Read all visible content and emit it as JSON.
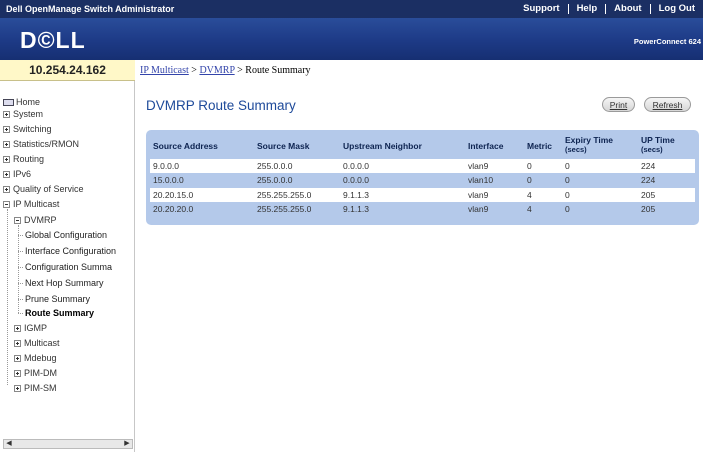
{
  "app": {
    "title": "Dell OpenManage Switch Administrator",
    "links": [
      "Support",
      "Help",
      "About",
      "Log Out"
    ],
    "logo": "D©LL",
    "product": "PowerConnect 624"
  },
  "ip_address": "10.254.24.162",
  "breadcrumb": {
    "items": [
      "IP Multicast",
      "DVMRP",
      "Route Summary"
    ],
    "separator": ">"
  },
  "sidebar": {
    "home": "Home",
    "top_items": [
      "System",
      "Switching",
      "Statistics/RMON",
      "Routing",
      "IPv6",
      "Quality of Service",
      "IP Multicast"
    ],
    "multicast_child": "DVMRP",
    "dvmrp_children": [
      "Global Configuration",
      "Interface Configuration",
      "Configuration Summa",
      "Next Hop Summary",
      "Prune Summary",
      "Route Summary"
    ],
    "multicast_items": [
      "IGMP",
      "Multicast",
      "Mdebug",
      "PIM-DM",
      "PIM-SM"
    ]
  },
  "content": {
    "title": "DVMRP Route Summary",
    "buttons": {
      "print": "Print",
      "refresh": "Refresh"
    }
  },
  "table": {
    "headers": {
      "source_address": "Source Address",
      "source_mask": "Source Mask",
      "upstream_neighbor": "Upstream Neighbor",
      "interface": "Interface",
      "metric": "Metric",
      "expiry_time": "Expiry Time",
      "expiry_time_unit": "(secs)",
      "up_time": "UP Time",
      "up_time_unit": "(secs)"
    },
    "rows": [
      [
        "9.0.0.0",
        "255.0.0.0",
        "0.0.0.0",
        "vlan9",
        "0",
        "0",
        "224"
      ],
      [
        "15.0.0.0",
        "255.0.0.0",
        "0.0.0.0",
        "vlan10",
        "0",
        "0",
        "224"
      ],
      [
        "20.20.15.0",
        "255.255.255.0",
        "9.1.1.3",
        "vlan9",
        "4",
        "0",
        "205"
      ],
      [
        "20.20.20.0",
        "255.255.255.0",
        "9.1.1.3",
        "vlan9",
        "4",
        "0",
        "205"
      ]
    ]
  },
  "colors": {
    "title_bar": "#1b2f63",
    "banner": "#1d3a86",
    "ip_box": "#fff8c8",
    "page_title": "#1e4a9a",
    "table_bg": "#b4c9ea"
  }
}
